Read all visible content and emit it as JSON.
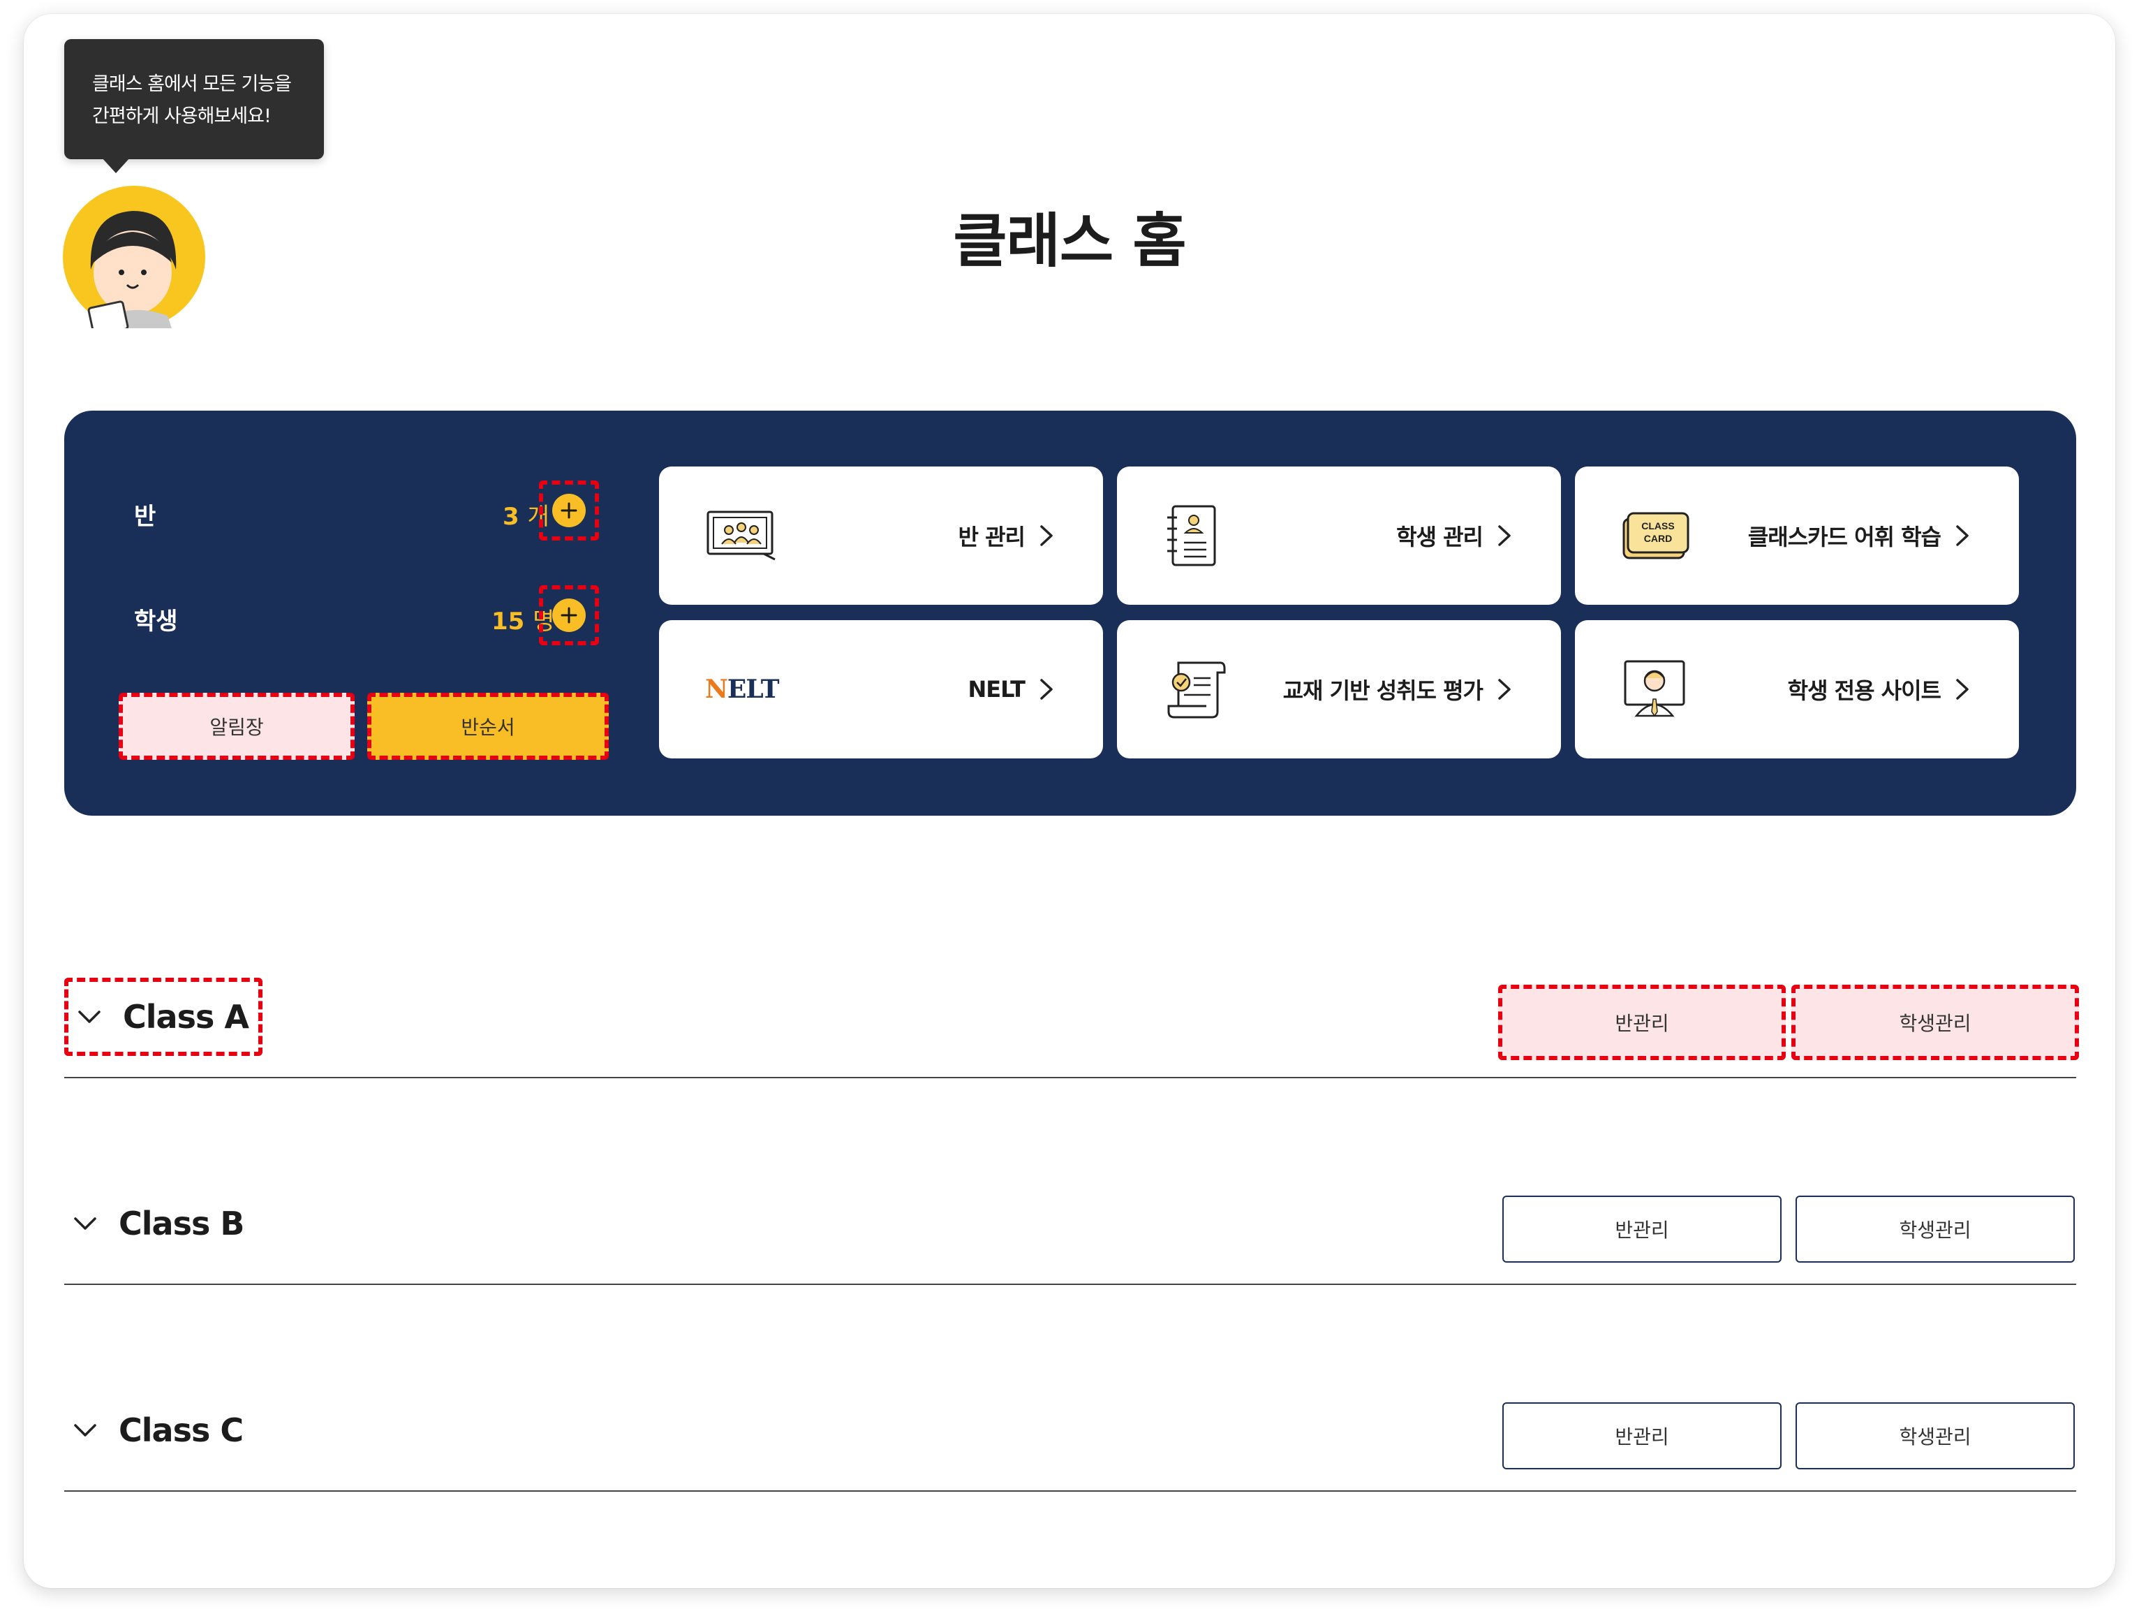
{
  "tooltip": {
    "line1": "클래스 홈에서 모든 기능을",
    "line2": "간편하게 사용해보세요!"
  },
  "page_title": "클래스 홈",
  "stats": {
    "classes": {
      "label": "반",
      "value": "3",
      "unit": "개"
    },
    "students": {
      "label": "학생",
      "value": "15",
      "unit": "명"
    }
  },
  "quick_buttons": {
    "notice": "알림장",
    "order": "반순서"
  },
  "tiles": [
    {
      "label": "반 관리",
      "icon": "classroom-icon"
    },
    {
      "label": "학생 관리",
      "icon": "student-notebook-icon"
    },
    {
      "label": "클래스카드 어휘 학습",
      "icon": "class-card-icon",
      "badge_line1": "CLASS",
      "badge_line2": "CARD"
    },
    {
      "label": "NELT",
      "icon": "nelt-logo",
      "logo_n": "N",
      "logo_rest": "ELT"
    },
    {
      "label": "교재 기반 성취도 평가",
      "icon": "scroll-check-icon"
    },
    {
      "label": "학생 전용 사이트",
      "icon": "student-board-icon"
    }
  ],
  "classes": [
    {
      "name": "Class A",
      "btn_class": "반관리",
      "btn_students": "학생관리"
    },
    {
      "name": "Class B",
      "btn_class": "반관리",
      "btn_students": "학생관리"
    },
    {
      "name": "Class C",
      "btn_class": "반관리",
      "btn_students": "학생관리"
    }
  ],
  "colors": {
    "navy": "#1a2f58",
    "yellow": "#f9be25",
    "highlight": "#e60012",
    "pink": "#fde4e6"
  }
}
